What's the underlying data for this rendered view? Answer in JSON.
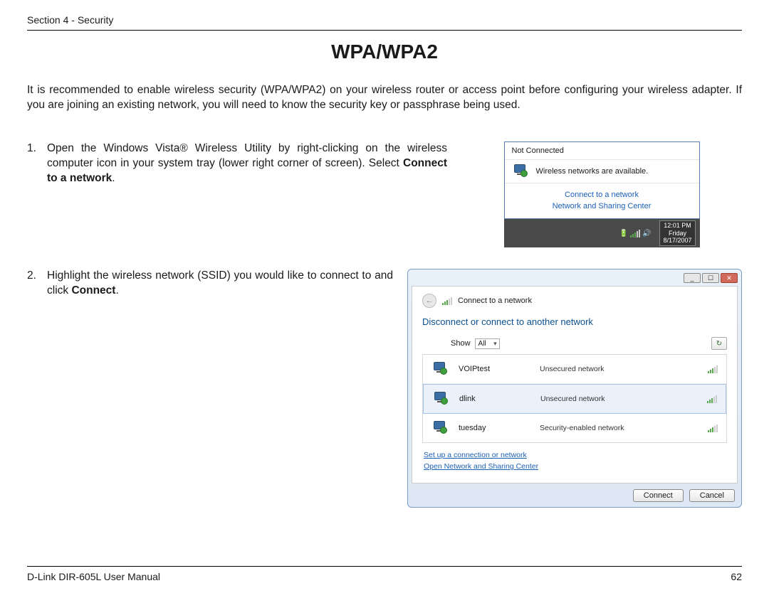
{
  "header": {
    "section": "Section 4 - Security"
  },
  "title": "WPA/WPA2",
  "intro": "It is recommended to enable wireless security (WPA/WPA2) on your wireless router or access point before configuring your wireless adapter. If you are joining an existing network, you will need to know the security key or passphrase being used.",
  "steps": {
    "one_num": "1.",
    "one_a": "Open the Windows Vista® Wireless Utility by right-clicking on the wireless computer icon in your system tray (lower right corner of screen). Select ",
    "one_b": "Connect to a network",
    "one_c": ".",
    "two_num": "2.",
    "two_a": "Highlight the wireless network (SSID) you would like to connect to and click ",
    "two_b": "Connect",
    "two_c": "."
  },
  "popup": {
    "status": "Not Connected",
    "message": "Wireless networks are available.",
    "link1": "Connect to a network",
    "link2": "Network and Sharing Center",
    "clock_time": "12:01 PM",
    "clock_day": "Friday",
    "clock_date": "8/17/2007"
  },
  "vista": {
    "breadcrumb": "Connect to a network",
    "heading": "Disconnect or connect to another network",
    "show_label": "Show",
    "show_value": "All",
    "networks": [
      {
        "name": "VOIPtest",
        "sec": "Unsecured network"
      },
      {
        "name": "dlink",
        "sec": "Unsecured network"
      },
      {
        "name": "tuesday",
        "sec": "Security-enabled network"
      }
    ],
    "link1": "Set up a connection or network",
    "link2": "Open Network and Sharing Center",
    "btn_connect": "Connect",
    "btn_cancel": "Cancel"
  },
  "footer": {
    "left": "D-Link DIR-605L User Manual",
    "right": "62"
  }
}
